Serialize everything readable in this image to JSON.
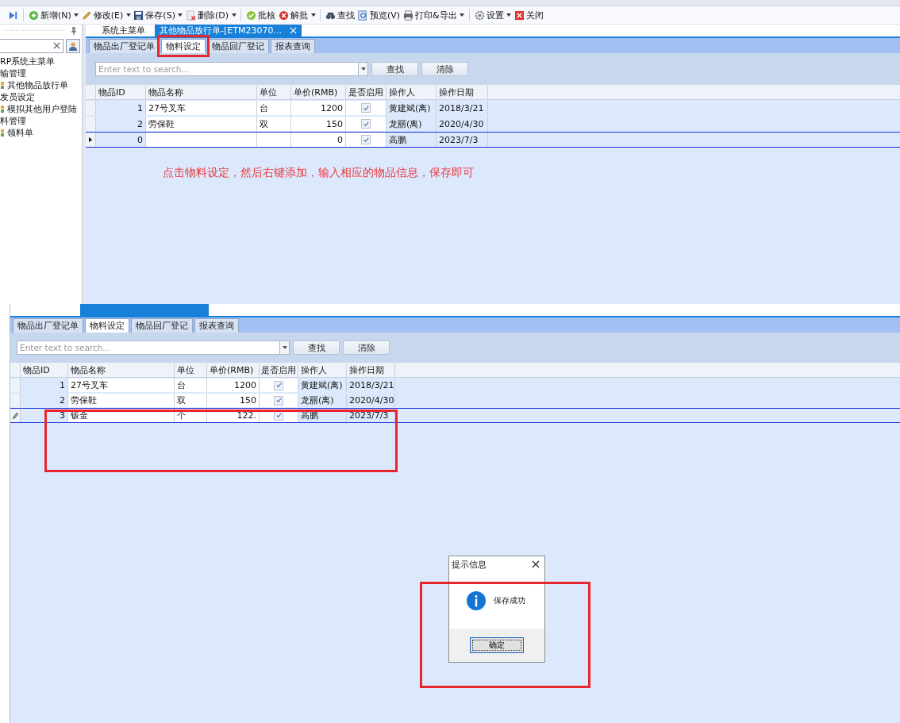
{
  "top_screenshot": {
    "toolbar": [
      {
        "has_menu": false
      },
      {
        "label": "新增(N)",
        "has_menu": true
      },
      {
        "label": "修改(E)",
        "has_menu": true
      },
      {
        "label": "保存(S)",
        "has_menu": true
      },
      {
        "label": "删除(D)",
        "has_menu": true
      },
      {
        "label": "批核",
        "has_menu": false
      },
      {
        "label": "解批",
        "has_menu": true
      },
      {
        "label": "查找",
        "has_menu": false
      },
      {
        "label": "预览(V)",
        "has_menu": false
      },
      {
        "label": "打印&导出",
        "has_menu": true
      },
      {
        "label": "设置",
        "has_menu": true
      },
      {
        "label": "关闭",
        "has_menu": false
      }
    ],
    "side_panel": {
      "tree": [
        {
          "label": "RP系统主菜单"
        },
        {
          "label": "输管理",
          "children": [
            {
              "label": "其他物品放行单"
            }
          ]
        },
        {
          "label": "发员设定",
          "children": [
            {
              "label": "模拟其他用户登陆"
            }
          ]
        },
        {
          "label": "料管理",
          "children": [
            {
              "label": "领料单"
            }
          ]
        }
      ]
    },
    "document_tabs": [
      {
        "label": "系统主菜单",
        "selected": false
      },
      {
        "label": "其他物品放行单-[ETM23070...",
        "selected": true
      }
    ],
    "sub_tabs": [
      {
        "label": "物品出厂登记单",
        "selected": false,
        "highlighted": false
      },
      {
        "label": "物料设定",
        "selected": true,
        "highlighted": true
      },
      {
        "label": "物品回厂登记",
        "selected": false,
        "highlighted": false
      },
      {
        "label": "报表查询",
        "selected": false,
        "highlighted": false
      }
    ],
    "search": {
      "placeholder": "Enter text to search..."
    },
    "buttons": [
      "查找",
      "清除"
    ],
    "table": {
      "columns": [
        "物品ID",
        "物品名称",
        "单位",
        "单价(RMB)",
        "是否启用",
        "操作人",
        "操作日期"
      ],
      "rows": [
        {
          "id": "1",
          "name": "27号叉车",
          "unit": "台",
          "price": "1200",
          "enabled": true,
          "operator": "黄建斌(离)",
          "date": "2018/3/21",
          "selected": false,
          "editing": false
        },
        {
          "id": "2",
          "name": "劳保鞋",
          "unit": "双",
          "price": "150",
          "enabled": true,
          "operator": "龙丽(离)",
          "date": "2020/4/30",
          "selected": false,
          "editing": false
        },
        {
          "id": "0",
          "price": "0",
          "enabled": true,
          "operator": "高鹏",
          "date": "2023/7/3",
          "selected": true,
          "editing": false
        }
      ]
    },
    "note": "点击物料设定，然后右键添加，输入相应的物品信息，保存即可"
  },
  "bottom_screenshot": {
    "sub_tabs": [
      {
        "label": "物品出厂登记单",
        "selected": false
      },
      {
        "label": "物料设定",
        "selected": true
      },
      {
        "label": "物品回厂登记",
        "selected": false
      },
      {
        "label": "报表查询",
        "selected": false
      }
    ],
    "search": {
      "placeholder": "Enter text to search..."
    },
    "buttons": [
      "查找",
      "清除"
    ],
    "table": {
      "columns": [
        "物品ID",
        "物品名称",
        "单位",
        "单价(RMB)",
        "是否启用",
        "操作人",
        "操作日期"
      ],
      "rows": [
        {
          "id": "1",
          "name": "27号叉车",
          "unit": "台",
          "price": "1200",
          "enabled": true,
          "operator": "黄建斌(离)",
          "date": "2018/3/21",
          "selected": false,
          "editing": false
        },
        {
          "id": "2",
          "name": "劳保鞋",
          "unit": "双",
          "price": "150",
          "enabled": true,
          "operator": "龙丽(离)",
          "date": "2020/4/30",
          "selected": false,
          "editing": false
        },
        {
          "id": "3",
          "name": "钣金",
          "unit": "个",
          "price": "122.",
          "enabled": true,
          "operator": "高鹏",
          "date": "2023/7/3",
          "selected": true,
          "editing": true
        }
      ]
    },
    "dialog": {
      "title": "提示信息",
      "message": "保存成功",
      "button": "确定"
    }
  }
}
